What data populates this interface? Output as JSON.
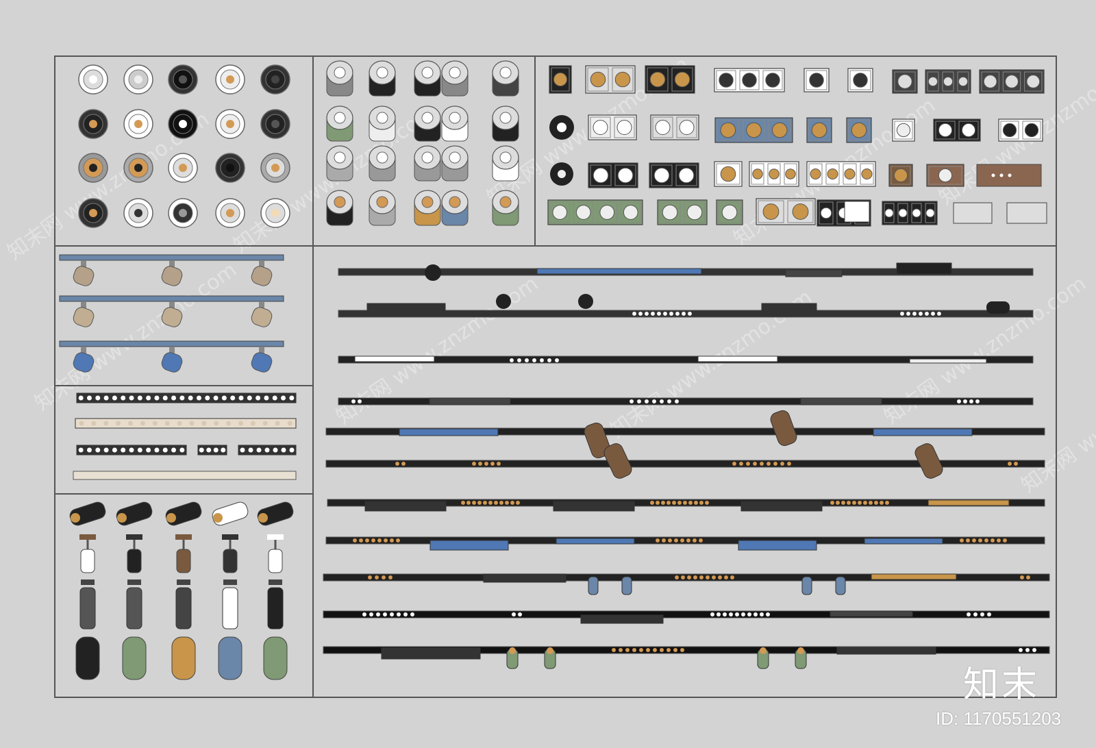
{
  "catalog": {
    "brand_text": "知末",
    "id_label": "ID:",
    "id_value": "1170551203",
    "watermark_text": "知末网 www.znzmo.com",
    "watermark_short": "知末网",
    "panels": [
      "recessed-round-downlights",
      "surface-cylinder-downlights",
      "recessed-grille-lights",
      "track-spotlights",
      "linear-grille-strips",
      "pendant-spotlights",
      "magnetic-track-systems"
    ]
  },
  "colors": {
    "background": "#d3d3d3",
    "frame": "#555555",
    "black_housing": "#222222",
    "warm_led": "#d39a55",
    "blue_accent": "#4f78b4",
    "slate_blue": "#6a86a8",
    "sage_green": "#7f9a74",
    "mustard": "#c8954a",
    "brown": "#7a5a3f",
    "white": "#f4f4f4"
  }
}
